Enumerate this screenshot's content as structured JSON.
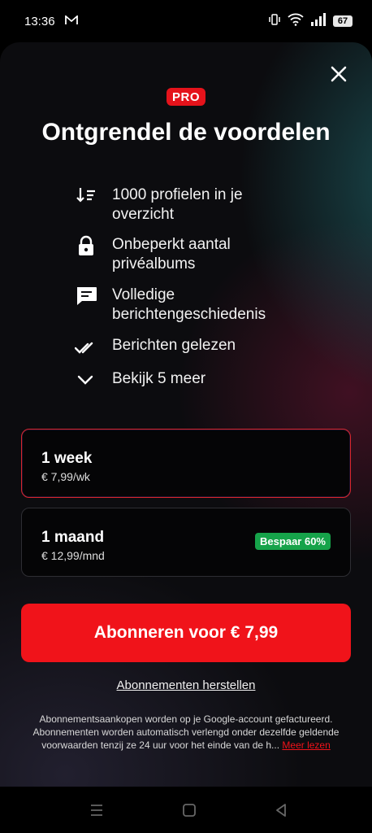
{
  "status_bar": {
    "time": "13:36",
    "battery": "67"
  },
  "header": {
    "badge": "PRO",
    "title": "Ontgrendel de voordelen"
  },
  "features": [
    {
      "icon": "sort-icon",
      "line1": "1000 profielen in je",
      "line2": "overzicht"
    },
    {
      "icon": "lock-icon",
      "line1": "Onbeperkt aantal",
      "line2": "privéalbums"
    },
    {
      "icon": "chat-icon",
      "line1": "Volledige",
      "line2": "berichtengeschiedenis"
    },
    {
      "icon": "double-check-icon",
      "line1": "Berichten gelezen"
    },
    {
      "icon": "chevron-down-icon",
      "line1": "Bekijk 5 meer"
    }
  ],
  "plans": [
    {
      "name": "1 week",
      "price": "€ 7,99/wk",
      "selected": true
    },
    {
      "name": "1 maand",
      "price": "€ 12,99/mnd",
      "badge": "Bespaar 60%"
    }
  ],
  "cta_label": "Abonneren voor € 7,99",
  "restore_label": "Abonnementen herstellen",
  "legal": {
    "line1": "Abonnementsaankopen worden op je Google-account gefactureerd.",
    "line2": "Abonnementen worden automatisch verlengd onder dezelfde geldende",
    "line3": "voorwaarden tenzij ze 24 uur voor het einde van de h...",
    "read_more": "Meer lezen"
  },
  "colors": {
    "accent": "#f0131a",
    "save_badge": "#16a34a",
    "background": "#0c0c0f"
  }
}
